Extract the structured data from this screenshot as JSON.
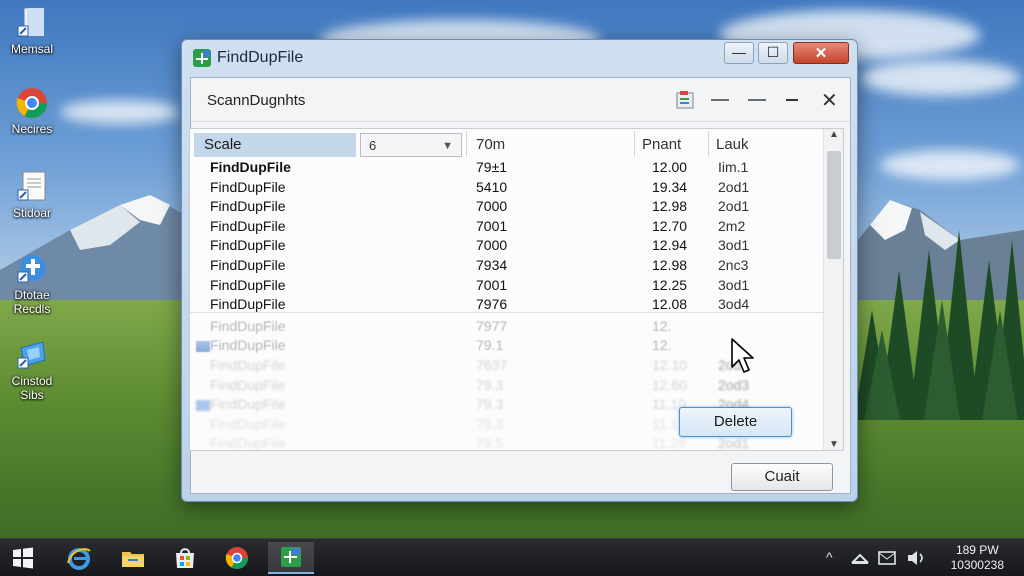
{
  "desktop": {
    "icons": [
      {
        "label": "Memsal"
      },
      {
        "label": "Necires"
      },
      {
        "label": "Stidoar"
      },
      {
        "label": "Dtotae\nRecdls"
      },
      {
        "label": "Cinstod\nSibs"
      }
    ]
  },
  "window": {
    "title": "FindDupFile",
    "controls": {
      "minimize": "—",
      "maximize": "☐",
      "close": "✕"
    },
    "toolbar": {
      "title": "ScannDugnhts",
      "close_glyph": "✕"
    },
    "grid": {
      "headers": {
        "scale": "Scale",
        "select_value": "6",
        "col2": "70m",
        "col3": "Pnant",
        "col4": "Lauk"
      },
      "rows": [
        {
          "name": "FindDupFile",
          "size": "79±1",
          "value": "12.00",
          "tag": "Iim.1"
        },
        {
          "name": "FindDupFile",
          "size": "5410",
          "value": "19.34",
          "tag": "2od1"
        },
        {
          "name": "FindDupFile",
          "size": "7000",
          "value": "12.98",
          "tag": "2od1"
        },
        {
          "name": "FindDupFile",
          "size": "7001",
          "value": "12.70",
          "tag": "2m2"
        },
        {
          "name": "FindDupFile",
          "size": "7000",
          "value": "12.94",
          "tag": "3od1"
        },
        {
          "name": "FindDupFile",
          "size": "7934",
          "value": "12.98",
          "tag": "2nc3"
        },
        {
          "name": "FindDupFile",
          "size": "7001",
          "value": "12.25",
          "tag": "3od1"
        },
        {
          "name": "FindDupFile",
          "size": "7976",
          "value": "12.08",
          "tag": "3od4"
        },
        {
          "name": "FindDupFile",
          "size": "7977",
          "value": "12.",
          "tag": ""
        },
        {
          "name": "FindDupFile",
          "size": "79.1",
          "value": "12.",
          "tag": ""
        },
        {
          "name": "FindDupFile",
          "size": "7637",
          "value": "12.10",
          "tag": "2od1"
        },
        {
          "name": "FindDupFile",
          "size": "79.3",
          "value": "12.60",
          "tag": "2od3"
        },
        {
          "name": "FindDupFile",
          "size": "79.3",
          "value": "11.10",
          "tag": "2od4"
        },
        {
          "name": "FindDupFile",
          "size": "79.3",
          "value": "11.11",
          "tag": "2od3"
        },
        {
          "name": "FindDupFile",
          "size": "79.5",
          "value": "11.28",
          "tag": "2od1"
        }
      ]
    },
    "delete_label": "Delete",
    "quit_label": "Cuait"
  },
  "taskbar": {
    "apps": [
      "start-icon",
      "internet-explorer-icon",
      "file-explorer-icon",
      "store-icon",
      "chrome-icon",
      "finddupfile-icon"
    ],
    "tray": {
      "caret": "^"
    },
    "clock": {
      "time": "189 PW",
      "date": "10300238"
    }
  },
  "colors": {
    "accent": "#4e8fd2",
    "close_red": "#c7432c",
    "header_select": "#c4d6ea"
  }
}
